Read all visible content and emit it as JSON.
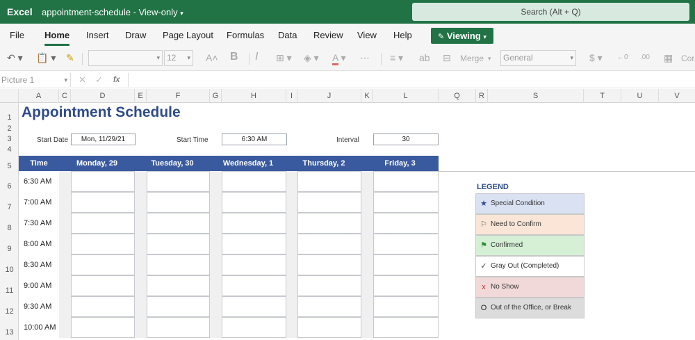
{
  "titlebar": {
    "app": "Excel",
    "document": "appointment-schedule - View-only",
    "search_placeholder": "Search (Alt + Q)"
  },
  "ribbon": {
    "tabs": [
      "File",
      "Home",
      "Insert",
      "Draw",
      "Page Layout",
      "Formulas",
      "Data",
      "Review",
      "View",
      "Help"
    ],
    "active_tab": "Home",
    "viewing_button": "Viewing"
  },
  "toolbar": {
    "font_size": "12",
    "bold": "B",
    "merge_label": "Merge",
    "number_format": "General",
    "cell_styles_label": "Cor"
  },
  "formula_bar": {
    "name_box": "Picture 1",
    "fx_label": "fx"
  },
  "columns": [
    "A",
    "C",
    "D",
    "E",
    "F",
    "G",
    "H",
    "I",
    "J",
    "K",
    "L",
    "Q",
    "R",
    "S",
    "T",
    "U",
    "V"
  ],
  "rows": [
    "1",
    "2",
    "3",
    "4",
    "5",
    "6",
    "7",
    "8",
    "9",
    "10",
    "11",
    "12",
    "13"
  ],
  "sheet": {
    "title": "Appointment Schedule",
    "start_date_label": "Start Date",
    "start_date_value": "Mon, 11/29/21",
    "start_time_label": "Start Time",
    "start_time_value": "6:30 AM",
    "interval_label": "Interval",
    "interval_value": "30",
    "header": [
      "Time",
      "Monday, 29",
      "Tuesday, 30",
      "Wednesday, 1",
      "Thursday, 2",
      "Friday, 3"
    ],
    "times": [
      "6:30 AM",
      "7:00 AM",
      "7:30 AM",
      "8:00 AM",
      "8:30 AM",
      "9:00 AM",
      "9:30 AM",
      "10:00 AM"
    ]
  },
  "legend": {
    "title": "LEGEND",
    "items": [
      {
        "symbol": "★",
        "label": "Special Condition",
        "color": "#d9e1f2"
      },
      {
        "symbol": "⚐",
        "label": "Need to Confirm",
        "color": "#fbe5d6"
      },
      {
        "symbol": "⚑",
        "label": "Confirmed",
        "color": "#d5f0d5"
      },
      {
        "symbol": "✓",
        "label": "Gray Out (Completed)",
        "color": "#ffffff"
      },
      {
        "symbol": "x",
        "label": "No Show",
        "color": "#f2d9d9"
      },
      {
        "symbol": "O",
        "label": "Out of the Office, or Break",
        "color": "#dcdcdc"
      }
    ]
  },
  "colors": {
    "excel_green": "#217346",
    "header_blue": "#3a5aa0",
    "title_blue": "#2f4b8a"
  }
}
